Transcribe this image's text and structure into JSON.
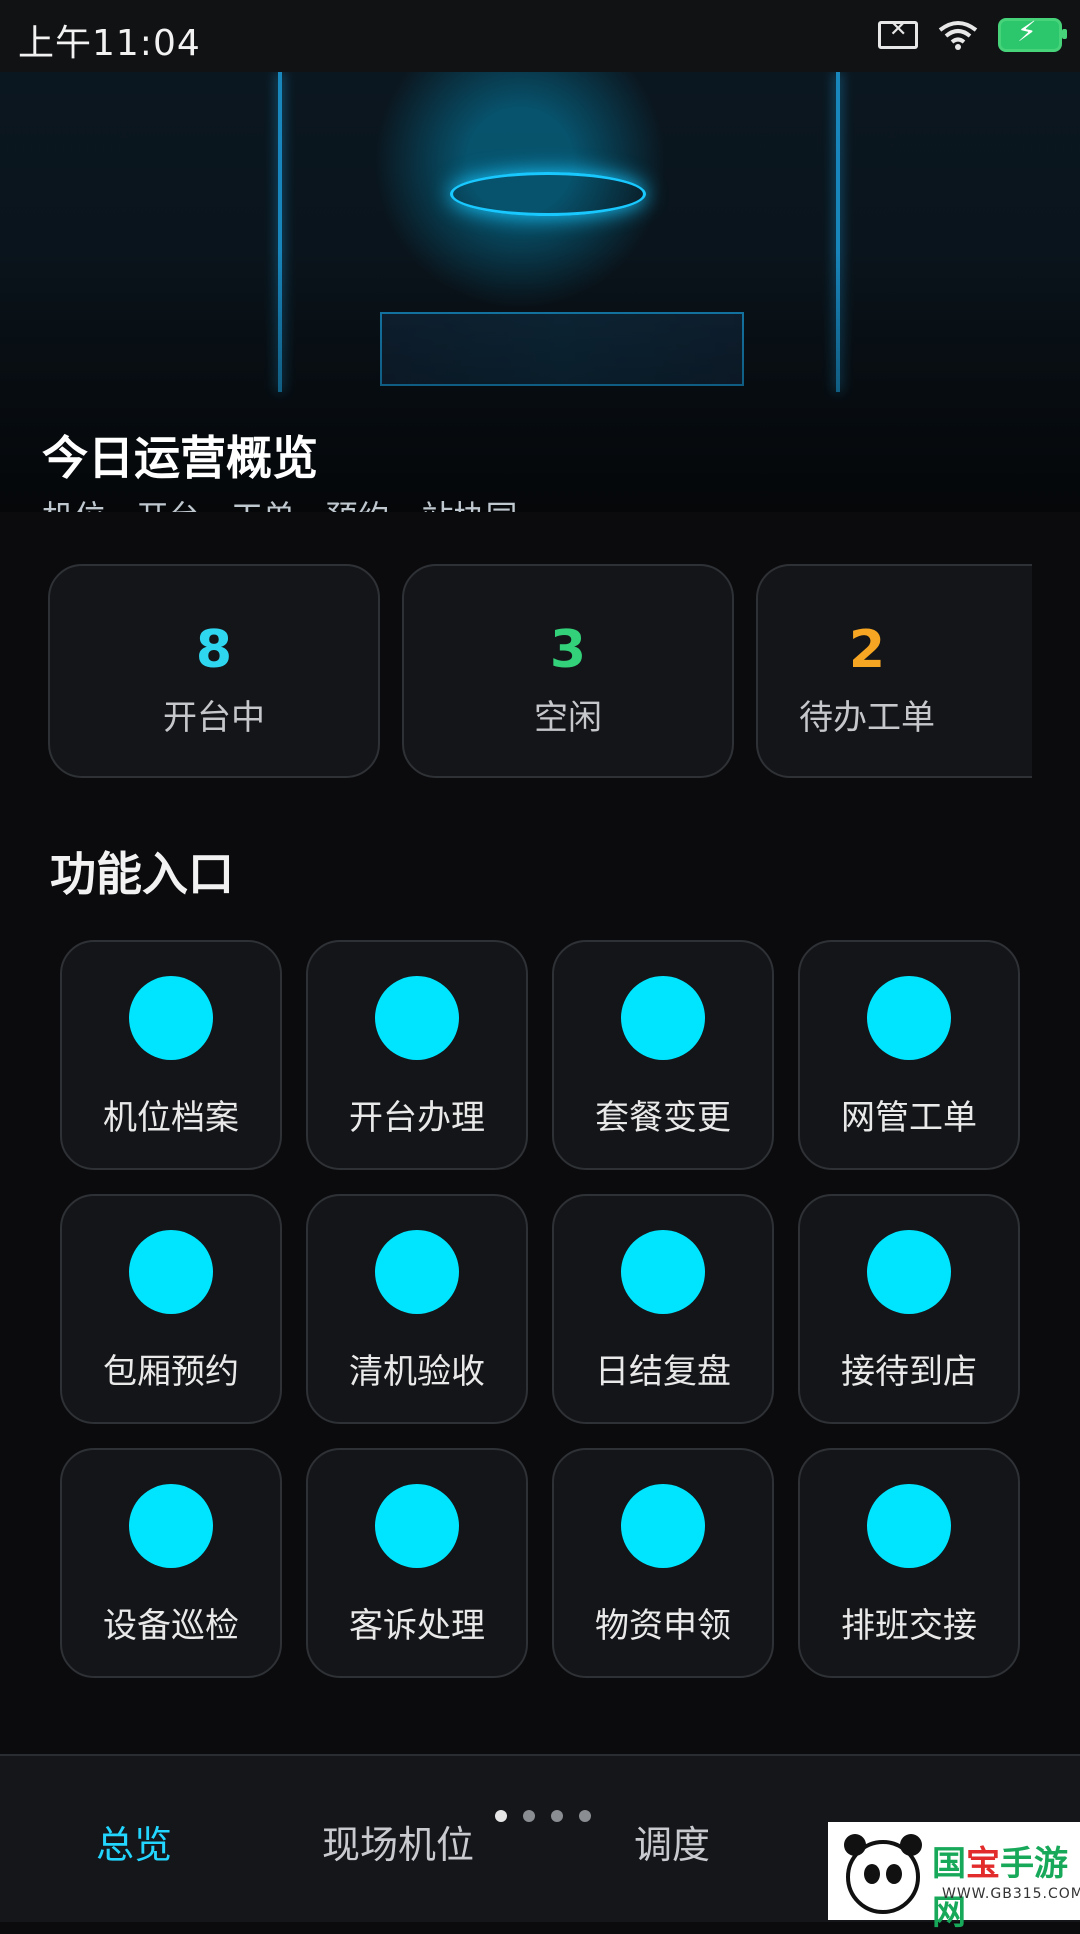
{
  "status_bar": {
    "time": "上午11:04"
  },
  "banner": {
    "title": "今日运营概览",
    "subtitle": "机位 · 开台 · 工单 · 预约一站协同"
  },
  "stats": [
    {
      "value": "8",
      "label": "开台中",
      "color": "#2ed6f0"
    },
    {
      "value": "3",
      "label": "空闲",
      "color": "#33d17a"
    },
    {
      "value": "2",
      "label": "待办工单",
      "color": "#f6a623"
    }
  ],
  "functions": {
    "title": "功能入口",
    "items": [
      "机位档案",
      "开台办理",
      "套餐变更",
      "网管工单",
      "包厢预约",
      "清机验收",
      "日结复盘",
      "接待到店",
      "设备巡检",
      "客诉处理",
      "物资申领",
      "排班交接"
    ],
    "accent": "#00e5ff"
  },
  "bottom_nav": {
    "tabs": [
      {
        "label": "总览",
        "active": true
      },
      {
        "label": "现场机位",
        "active": false
      },
      {
        "label": "调度",
        "active": false
      }
    ],
    "pager": {
      "count": 4,
      "active_index": 0
    }
  },
  "watermark": {
    "brand_a": "国",
    "brand_b": "宝",
    "brand_c": "手游网",
    "url": "WWW.GB315.COM"
  }
}
